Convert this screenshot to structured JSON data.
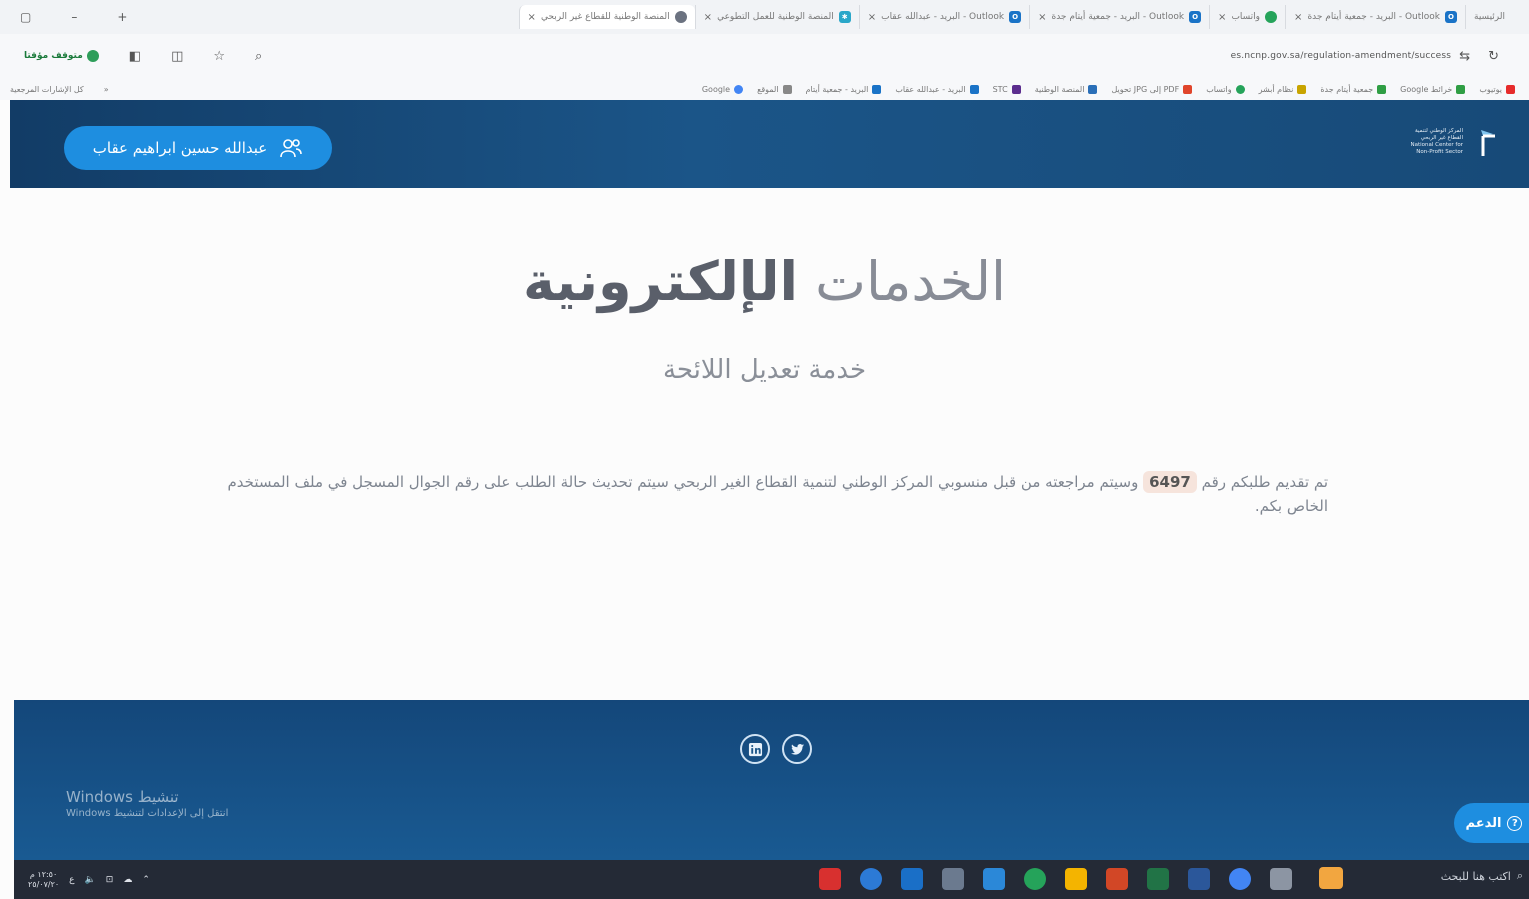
{
  "browser": {
    "tabs": [
      {
        "label": "الرئيسية",
        "color": "#ffffff"
      },
      {
        "label": "البريد - جمعية أيتام جدة - Outlook",
        "color": "#1a73c7"
      },
      {
        "label": "واتساب",
        "color": "#25a35a"
      },
      {
        "label": "البريد - جمعية أيتام جدة - Outlook",
        "color": "#1a73c7"
      },
      {
        "label": "البريد - عبدالله عقاب - Outlook",
        "color": "#1a73c7"
      },
      {
        "label": "المنصة الوطنية للعمل التطوعي",
        "color": "#2aa7c9"
      },
      {
        "label": "المنصة الوطنية للقطاع غير الربحي",
        "color": "#6b7280"
      }
    ],
    "tab_close": "×",
    "new_tab": "+",
    "minimize": "–",
    "restore": "▢",
    "address": "es.ncnp.gov.sa/regulation-amendment/success",
    "paused_label": "متوقف مؤقتا",
    "bookmarks": [
      {
        "label": "يوتيوب",
        "color": "#e62b2b"
      },
      {
        "label": "Google خرائط",
        "color": "#2f9e44"
      },
      {
        "label": "جمعية أيتام جدة",
        "color": "#2f9e44"
      },
      {
        "label": "نظام أبشر",
        "color": "#c8a400"
      },
      {
        "label": "واتساب",
        "color": "#25a35a"
      },
      {
        "label": "تحويل JPG إلى PDF",
        "color": "#e0452b"
      },
      {
        "label": "المنصة الوطنية",
        "color": "#2a6fb8"
      },
      {
        "label": "STC",
        "color": "#5b2d8e"
      },
      {
        "label": "البريد - عبدالله عقاب",
        "color": "#1a73c7"
      },
      {
        "label": "البريد - جمعية أيتام",
        "color": "#1a73c7"
      },
      {
        "label": "الموقع",
        "color": "#888888"
      },
      {
        "label": "Google",
        "color": "#4285f4"
      }
    ],
    "bookmarks_all": "كل الإشارات المرجعية"
  },
  "header": {
    "user_name": "عبدالله حسين ابراهيم عقاب",
    "logo_lines": [
      "المركز الوطني لتنمية",
      "القطاع غير الربحي",
      "National Center for",
      "Non-Profit Sector"
    ]
  },
  "main": {
    "title_light": "الخدمات",
    "title_bold": "الإلكترونية",
    "subtitle": "خدمة تعديل اللائحة",
    "message_before": "تم تقديم طلبكم رقم",
    "request_number": "6497",
    "message_after": "وسيتم مراجعته من قبل منسوبي المركز الوطني لتنمية القطاع الغير الربحي سيتم تحديث حالة الطلب على رقم الجوال المسجل في ملف المستخدم الخاص بكم."
  },
  "footer": {
    "activate_title": "تنشيط Windows",
    "activate_sub": "انتقل إلى الإعدادات لتنشيط Windows",
    "support_label": "الدعم"
  },
  "taskbar": {
    "search_placeholder": "اكتب هنا للبحث",
    "time": "١٢:٥٠ م",
    "date": "٢٥/٠٧/٢٠",
    "lang": "ع",
    "apps": [
      {
        "name": "acrobat",
        "color": "#d8302f"
      },
      {
        "name": "chat",
        "color": "#2c7ad6"
      },
      {
        "name": "outlook",
        "color": "#1a6fc7"
      },
      {
        "name": "monitor",
        "color": "#6b7a8f"
      },
      {
        "name": "mail",
        "color": "#2b88d8"
      },
      {
        "name": "whatsapp",
        "color": "#25a35a"
      },
      {
        "name": "store",
        "color": "#f4b400"
      },
      {
        "name": "powerpoint",
        "color": "#d24726"
      },
      {
        "name": "excel",
        "color": "#217346"
      },
      {
        "name": "word",
        "color": "#2b579a"
      },
      {
        "name": "chrome",
        "color": "#4285f4"
      },
      {
        "name": "task-view",
        "color": "#8c95a3"
      }
    ]
  }
}
